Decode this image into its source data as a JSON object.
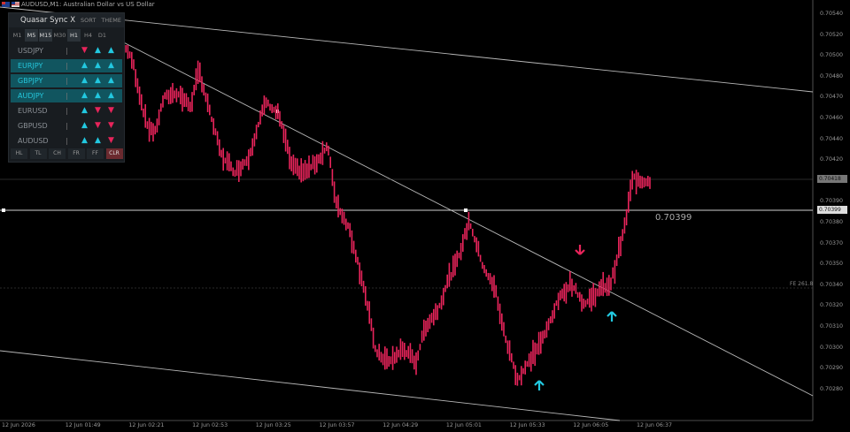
{
  "window": {
    "title": "AUDUSD,M1:  Australian Dollar vs US Dollar"
  },
  "panel": {
    "title": "Quasar Sync X",
    "sort_label": "SORT",
    "theme_label": "THEME",
    "timeframes": [
      {
        "label": "M1",
        "active": false
      },
      {
        "label": "M5",
        "active": true
      },
      {
        "label": "M15",
        "active": true
      },
      {
        "label": "M30",
        "active": false
      },
      {
        "label": "H1",
        "active": true
      },
      {
        "label": "H4",
        "active": false
      },
      {
        "label": "D1",
        "active": false
      }
    ],
    "symbols": [
      {
        "name": "USDJPY",
        "highlight": false,
        "signals": [
          "down",
          "up",
          "up"
        ]
      },
      {
        "name": "EURJPY",
        "highlight": true,
        "signals": [
          "up",
          "up",
          "up"
        ]
      },
      {
        "name": "GBPJPY",
        "highlight": true,
        "signals": [
          "up",
          "up",
          "up"
        ]
      },
      {
        "name": "AUDJPY",
        "highlight": true,
        "signals": [
          "up",
          "up",
          "up"
        ]
      },
      {
        "name": "EURUSD",
        "highlight": false,
        "signals": [
          "up",
          "down",
          "down"
        ]
      },
      {
        "name": "GBPUSD",
        "highlight": false,
        "signals": [
          "up",
          "down",
          "down"
        ]
      },
      {
        "name": "AUDUSD",
        "highlight": false,
        "signals": [
          "up",
          "up",
          "down"
        ]
      }
    ],
    "separator": "|",
    "bottom_buttons": [
      "HL",
      "TL",
      "CH",
      "FR",
      "FF",
      "CLR"
    ]
  },
  "price_axis": [
    "0.70540",
    "0.70520",
    "0.70500",
    "0.70480",
    "0.70470",
    "0.70460",
    "0.70440",
    "0.70420",
    "0.70410",
    "0.70390",
    "0.70380",
    "0.70370",
    "0.70350",
    "0.70340",
    "0.70320",
    "0.70310",
    "0.70300",
    "0.70290",
    "0.70280"
  ],
  "time_axis": [
    "12 Jun 2026",
    "12 Jun 01:49",
    "12 Jun 02:21",
    "12 Jun 02:53",
    "12 Jun 03:25",
    "12 Jun 03:57",
    "12 Jun 04:29",
    "12 Jun 05:01",
    "12 Jun 05:33",
    "12 Jun 06:05",
    "12 Jun 06:37"
  ],
  "current_price_tag": "0.70418",
  "level_tag": "0.70399",
  "level_label": "0.70399",
  "fe_label": "FE 261.8",
  "colors": {
    "candle": "#e8245b",
    "buy": "#22c8e0",
    "sell": "#e8245b",
    "highlight": "#11555f"
  }
}
